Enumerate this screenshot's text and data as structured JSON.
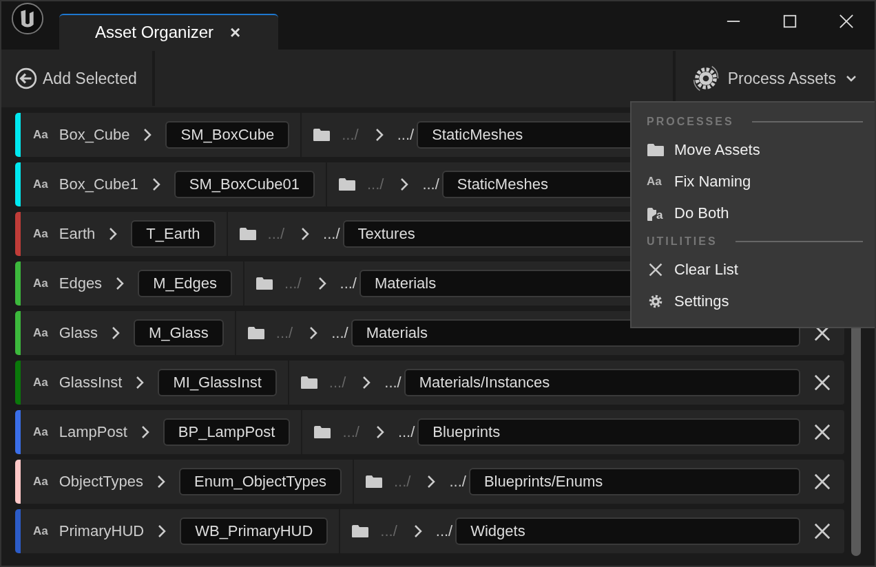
{
  "tab": {
    "title": "Asset Organizer",
    "close": "×"
  },
  "toolbar": {
    "add_selected": "Add Selected",
    "process_assets": "Process Assets"
  },
  "rows": [
    {
      "glyph": "Aa",
      "name": "Box_Cube",
      "new_name": "SM_BoxCube",
      "folder_from": ".../",
      "folder_prefix": ".../",
      "path": "StaticMeshes",
      "color": "#00e8f0"
    },
    {
      "glyph": "Aa",
      "name": "Box_Cube1",
      "new_name": "SM_BoxCube01",
      "folder_from": ".../",
      "folder_prefix": ".../",
      "path": "StaticMeshes",
      "color": "#00e8f0"
    },
    {
      "glyph": "Aa",
      "name": "Earth",
      "new_name": "T_Earth",
      "folder_from": ".../",
      "folder_prefix": ".../",
      "path": "Textures",
      "color": "#c03c38"
    },
    {
      "glyph": "Aa",
      "name": "Edges",
      "new_name": "M_Edges",
      "folder_from": ".../",
      "folder_prefix": ".../",
      "path": "Materials",
      "color": "#3cb83c"
    },
    {
      "glyph": "Aa",
      "name": "Glass",
      "new_name": "M_Glass",
      "folder_from": ".../",
      "folder_prefix": ".../",
      "path": "Materials",
      "color": "#3cb83c"
    },
    {
      "glyph": "Aa",
      "name": "GlassInst",
      "new_name": "MI_GlassInst",
      "folder_from": ".../",
      "folder_prefix": ".../",
      "path": "Materials/Instances",
      "color": "#0a780a"
    },
    {
      "glyph": "Aa",
      "name": "LampPost",
      "new_name": "BP_LampPost",
      "folder_from": ".../",
      "folder_prefix": ".../",
      "path": "Blueprints",
      "color": "#3a6ee8"
    },
    {
      "glyph": "Aa",
      "name": "ObjectTypes",
      "new_name": "Enum_ObjectTypes",
      "folder_from": ".../",
      "folder_prefix": ".../",
      "path": "Blueprints/Enums",
      "color": "#ffc8c8"
    },
    {
      "glyph": "Aa",
      "name": "PrimaryHUD",
      "new_name": "WB_PrimaryHUD",
      "folder_from": ".../",
      "folder_prefix": ".../",
      "path": "Widgets",
      "color": "#2c5cc8"
    }
  ],
  "menu": {
    "sections": [
      {
        "title": "PROCESSES",
        "items": [
          {
            "label": "Move Assets",
            "kind": "folder"
          },
          {
            "label": "Fix Naming",
            "kind": "text",
            "glyph": "Aa"
          },
          {
            "label": "Do Both",
            "kind": "both",
            "glyph": "a"
          }
        ]
      },
      {
        "title": "UTILITIES",
        "items": [
          {
            "label": "Clear List",
            "kind": "clear"
          },
          {
            "label": "Settings",
            "kind": "gear"
          }
        ]
      }
    ]
  }
}
